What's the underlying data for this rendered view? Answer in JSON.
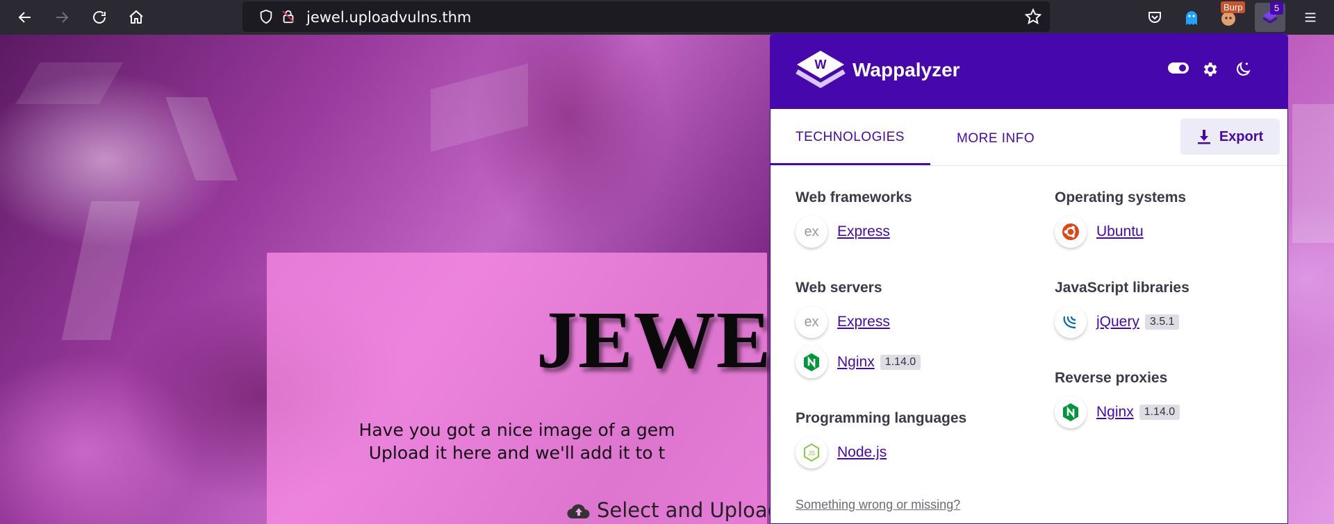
{
  "browser": {
    "url": "jewel.uploadvulns.thm",
    "badges": {
      "burp": "Burp",
      "wappalyzer_count": "5"
    }
  },
  "page": {
    "title": "JEWEL",
    "tagline_line1": "Have you got a nice image of a gem",
    "tagline_line2": "Upload it here and we'll add it to t",
    "upload_button": "Select and Upload"
  },
  "wappalyzer": {
    "brand": "Wappalyzer",
    "tabs": [
      {
        "label": "TECHNOLOGIES",
        "active": true
      },
      {
        "label": "MORE INFO",
        "active": false
      }
    ],
    "export_label": "Export",
    "left_column": [
      {
        "category": "Web frameworks",
        "technologies": [
          {
            "name": "Express",
            "icon": "express-icon"
          }
        ]
      },
      {
        "category": "Web servers",
        "technologies": [
          {
            "name": "Express",
            "icon": "express-icon"
          },
          {
            "name": "Nginx",
            "version": "1.14.0",
            "icon": "nginx-icon"
          }
        ]
      },
      {
        "category": "Programming languages",
        "technologies": [
          {
            "name": "Node.js",
            "icon": "nodejs-icon"
          }
        ]
      }
    ],
    "right_column": [
      {
        "category": "Operating systems",
        "technologies": [
          {
            "name": "Ubuntu",
            "icon": "ubuntu-icon"
          }
        ]
      },
      {
        "category": "JavaScript libraries",
        "technologies": [
          {
            "name": "jQuery",
            "version": "3.5.1",
            "icon": "jquery-icon"
          }
        ]
      },
      {
        "category": "Reverse proxies",
        "technologies": [
          {
            "name": "Nginx",
            "version": "1.14.0",
            "icon": "nginx-icon"
          }
        ]
      }
    ],
    "footer_link": "Something wrong or missing?"
  },
  "colors": {
    "wappalyzer_purple": "#4608ad",
    "browser_toolbar": "#2b2a33",
    "url_field": "#1c1b22"
  }
}
